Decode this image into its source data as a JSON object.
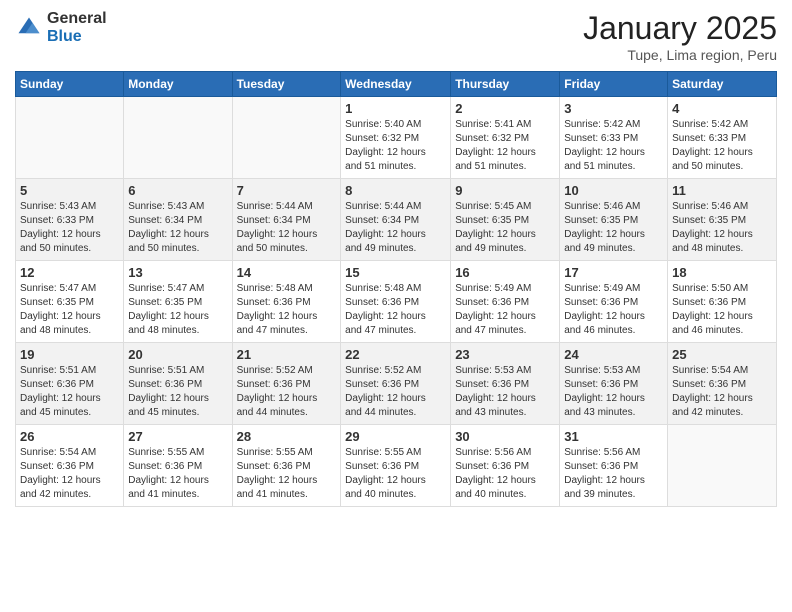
{
  "logo": {
    "general": "General",
    "blue": "Blue"
  },
  "header": {
    "title": "January 2025",
    "subtitle": "Tupe, Lima region, Peru"
  },
  "weekdays": [
    "Sunday",
    "Monday",
    "Tuesday",
    "Wednesday",
    "Thursday",
    "Friday",
    "Saturday"
  ],
  "weeks": [
    {
      "shade": "white",
      "days": [
        {
          "num": "",
          "info": ""
        },
        {
          "num": "",
          "info": ""
        },
        {
          "num": "",
          "info": ""
        },
        {
          "num": "1",
          "info": "Sunrise: 5:40 AM\nSunset: 6:32 PM\nDaylight: 12 hours\nand 51 minutes."
        },
        {
          "num": "2",
          "info": "Sunrise: 5:41 AM\nSunset: 6:32 PM\nDaylight: 12 hours\nand 51 minutes."
        },
        {
          "num": "3",
          "info": "Sunrise: 5:42 AM\nSunset: 6:33 PM\nDaylight: 12 hours\nand 51 minutes."
        },
        {
          "num": "4",
          "info": "Sunrise: 5:42 AM\nSunset: 6:33 PM\nDaylight: 12 hours\nand 50 minutes."
        }
      ]
    },
    {
      "shade": "shaded",
      "days": [
        {
          "num": "5",
          "info": "Sunrise: 5:43 AM\nSunset: 6:33 PM\nDaylight: 12 hours\nand 50 minutes."
        },
        {
          "num": "6",
          "info": "Sunrise: 5:43 AM\nSunset: 6:34 PM\nDaylight: 12 hours\nand 50 minutes."
        },
        {
          "num": "7",
          "info": "Sunrise: 5:44 AM\nSunset: 6:34 PM\nDaylight: 12 hours\nand 50 minutes."
        },
        {
          "num": "8",
          "info": "Sunrise: 5:44 AM\nSunset: 6:34 PM\nDaylight: 12 hours\nand 49 minutes."
        },
        {
          "num": "9",
          "info": "Sunrise: 5:45 AM\nSunset: 6:35 PM\nDaylight: 12 hours\nand 49 minutes."
        },
        {
          "num": "10",
          "info": "Sunrise: 5:46 AM\nSunset: 6:35 PM\nDaylight: 12 hours\nand 49 minutes."
        },
        {
          "num": "11",
          "info": "Sunrise: 5:46 AM\nSunset: 6:35 PM\nDaylight: 12 hours\nand 48 minutes."
        }
      ]
    },
    {
      "shade": "white",
      "days": [
        {
          "num": "12",
          "info": "Sunrise: 5:47 AM\nSunset: 6:35 PM\nDaylight: 12 hours\nand 48 minutes."
        },
        {
          "num": "13",
          "info": "Sunrise: 5:47 AM\nSunset: 6:35 PM\nDaylight: 12 hours\nand 48 minutes."
        },
        {
          "num": "14",
          "info": "Sunrise: 5:48 AM\nSunset: 6:36 PM\nDaylight: 12 hours\nand 47 minutes."
        },
        {
          "num": "15",
          "info": "Sunrise: 5:48 AM\nSunset: 6:36 PM\nDaylight: 12 hours\nand 47 minutes."
        },
        {
          "num": "16",
          "info": "Sunrise: 5:49 AM\nSunset: 6:36 PM\nDaylight: 12 hours\nand 47 minutes."
        },
        {
          "num": "17",
          "info": "Sunrise: 5:49 AM\nSunset: 6:36 PM\nDaylight: 12 hours\nand 46 minutes."
        },
        {
          "num": "18",
          "info": "Sunrise: 5:50 AM\nSunset: 6:36 PM\nDaylight: 12 hours\nand 46 minutes."
        }
      ]
    },
    {
      "shade": "shaded",
      "days": [
        {
          "num": "19",
          "info": "Sunrise: 5:51 AM\nSunset: 6:36 PM\nDaylight: 12 hours\nand 45 minutes."
        },
        {
          "num": "20",
          "info": "Sunrise: 5:51 AM\nSunset: 6:36 PM\nDaylight: 12 hours\nand 45 minutes."
        },
        {
          "num": "21",
          "info": "Sunrise: 5:52 AM\nSunset: 6:36 PM\nDaylight: 12 hours\nand 44 minutes."
        },
        {
          "num": "22",
          "info": "Sunrise: 5:52 AM\nSunset: 6:36 PM\nDaylight: 12 hours\nand 44 minutes."
        },
        {
          "num": "23",
          "info": "Sunrise: 5:53 AM\nSunset: 6:36 PM\nDaylight: 12 hours\nand 43 minutes."
        },
        {
          "num": "24",
          "info": "Sunrise: 5:53 AM\nSunset: 6:36 PM\nDaylight: 12 hours\nand 43 minutes."
        },
        {
          "num": "25",
          "info": "Sunrise: 5:54 AM\nSunset: 6:36 PM\nDaylight: 12 hours\nand 42 minutes."
        }
      ]
    },
    {
      "shade": "white",
      "days": [
        {
          "num": "26",
          "info": "Sunrise: 5:54 AM\nSunset: 6:36 PM\nDaylight: 12 hours\nand 42 minutes."
        },
        {
          "num": "27",
          "info": "Sunrise: 5:55 AM\nSunset: 6:36 PM\nDaylight: 12 hours\nand 41 minutes."
        },
        {
          "num": "28",
          "info": "Sunrise: 5:55 AM\nSunset: 6:36 PM\nDaylight: 12 hours\nand 41 minutes."
        },
        {
          "num": "29",
          "info": "Sunrise: 5:55 AM\nSunset: 6:36 PM\nDaylight: 12 hours\nand 40 minutes."
        },
        {
          "num": "30",
          "info": "Sunrise: 5:56 AM\nSunset: 6:36 PM\nDaylight: 12 hours\nand 40 minutes."
        },
        {
          "num": "31",
          "info": "Sunrise: 5:56 AM\nSunset: 6:36 PM\nDaylight: 12 hours\nand 39 minutes."
        },
        {
          "num": "",
          "info": ""
        }
      ]
    }
  ]
}
